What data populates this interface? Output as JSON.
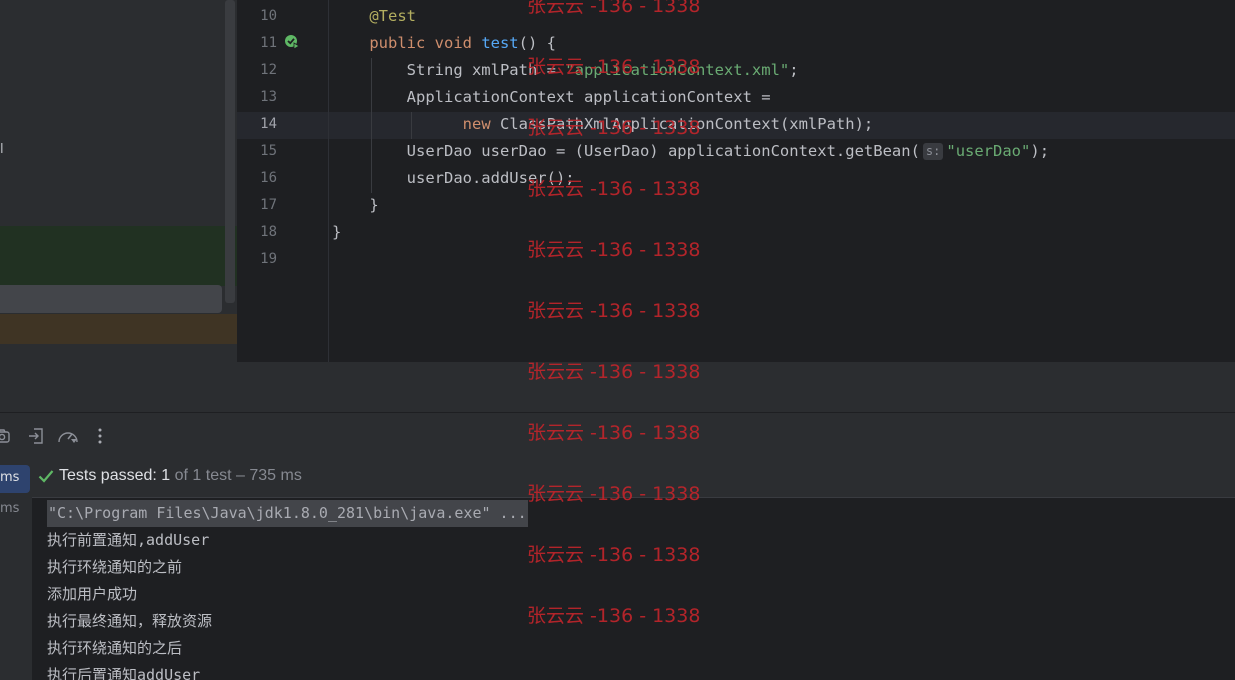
{
  "project_panel": {
    "cut_text": "l"
  },
  "editor": {
    "lines": [
      {
        "num": "10",
        "current": false,
        "tokens": [
          {
            "t": "    "
          },
          {
            "t": "@Test",
            "c": "ann"
          }
        ]
      },
      {
        "num": "11",
        "current": false,
        "tokens": [
          {
            "t": "    "
          },
          {
            "t": "public void ",
            "c": "kw"
          },
          {
            "t": "test",
            "c": "fn"
          },
          {
            "t": "() {"
          }
        ]
      },
      {
        "num": "12",
        "current": false,
        "tokens": [
          {
            "t": "        String xmlPath = "
          },
          {
            "t": "\"applicationContext.xml\"",
            "c": "str"
          },
          {
            "t": ";"
          }
        ]
      },
      {
        "num": "13",
        "current": false,
        "tokens": [
          {
            "t": "        ApplicationContext applicationContext ="
          }
        ]
      },
      {
        "num": "14",
        "current": true,
        "tokens": [
          {
            "t": "              "
          },
          {
            "t": "new ",
            "c": "kw"
          },
          {
            "t": "ClassPathXmlApplicationContext(xmlPath);"
          }
        ]
      },
      {
        "num": "15",
        "current": false,
        "tokens": [
          {
            "t": "        UserDao userDao = (UserDao) applicationContext.getBean("
          },
          {
            "t": "s:",
            "c": "inlay"
          },
          {
            "t": "\"userDao\"",
            "c": "str"
          },
          {
            "t": ");"
          }
        ]
      },
      {
        "num": "16",
        "current": false,
        "tokens": [
          {
            "t": "        userDao.addUser();"
          }
        ]
      },
      {
        "num": "17",
        "current": false,
        "tokens": [
          {
            "t": "    }"
          }
        ]
      },
      {
        "num": "18",
        "current": false,
        "tokens": [
          {
            "t": "}"
          }
        ]
      },
      {
        "num": "19",
        "current": false,
        "tokens": []
      }
    ]
  },
  "run_toolbar": {
    "icons": [
      "camera-icon",
      "import-icon",
      "speedometer-icon",
      "more-options-icon"
    ]
  },
  "test_tree": {
    "items": [
      "ms",
      "ms"
    ]
  },
  "status": {
    "passed_label": "Tests passed: ",
    "passed_count": "1",
    "summary": "of 1 test – 735 ms"
  },
  "console": {
    "lines": [
      "\"C:\\Program Files\\Java\\jdk1.8.0_281\\bin\\java.exe\" ...",
      "执行前置通知,addUser",
      "执行环绕通知的之前",
      "添加用户成功",
      "执行最终通知，释放资源",
      "执行环绕通知的之后",
      "执行后置通知addUser"
    ]
  },
  "watermark": {
    "text": "张云云 -136 - 1338",
    "color": "#c0252b",
    "count": 11
  },
  "colors": {
    "editor_bg": "#1e1f22",
    "panel_bg": "#2b2d30",
    "keyword": "#cf8e6d",
    "annotation": "#b3ae60",
    "function": "#56a8f5",
    "string": "#6aab73",
    "success": "#5fb865"
  }
}
